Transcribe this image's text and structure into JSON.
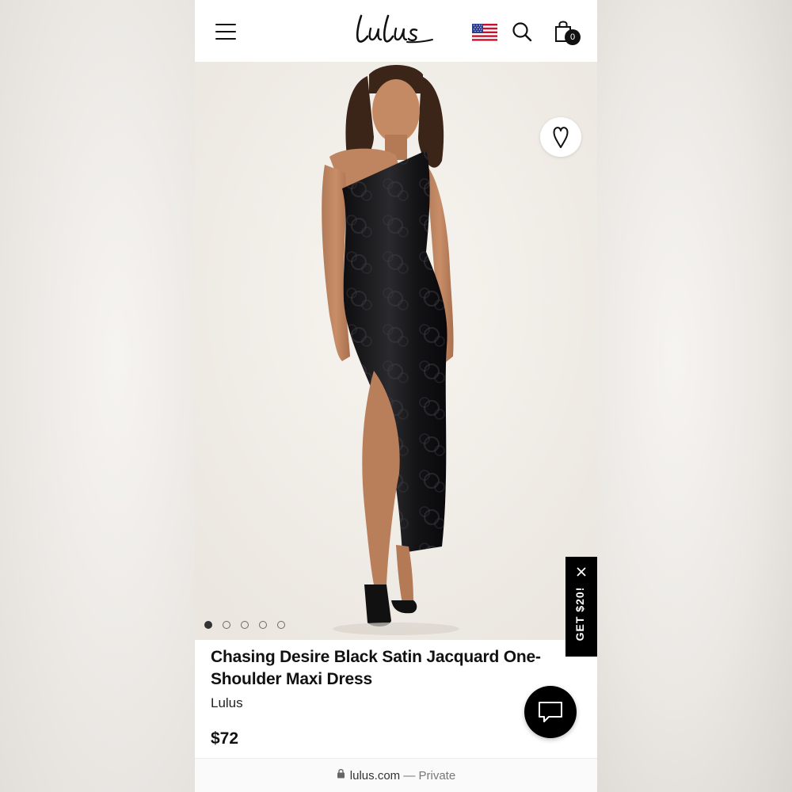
{
  "header": {
    "logo_text": "Lulus",
    "cart_count": "0",
    "flag_icon": "us-flag-icon",
    "menu_icon": "hamburger-menu-icon",
    "search_icon": "search-icon",
    "cart_icon": "shopping-bag-icon"
  },
  "gallery": {
    "wishlist_icon": "heart-icon",
    "slide_count": 5,
    "active_slide": 1
  },
  "promo": {
    "label": "GET $20!",
    "close_icon": "close-icon"
  },
  "product": {
    "title": "Chasing Desire Black Satin Jacquard One-Shoulder Maxi Dress",
    "brand": "Lulus",
    "price": "$72"
  },
  "chat": {
    "icon": "chat-bubble-icon"
  },
  "browser": {
    "domain": "lulus.com",
    "separator": "—",
    "mode": "Private",
    "lock_icon": "lock-icon"
  },
  "colors": {
    "accent": "#000000",
    "page_background": "#ffffff"
  }
}
